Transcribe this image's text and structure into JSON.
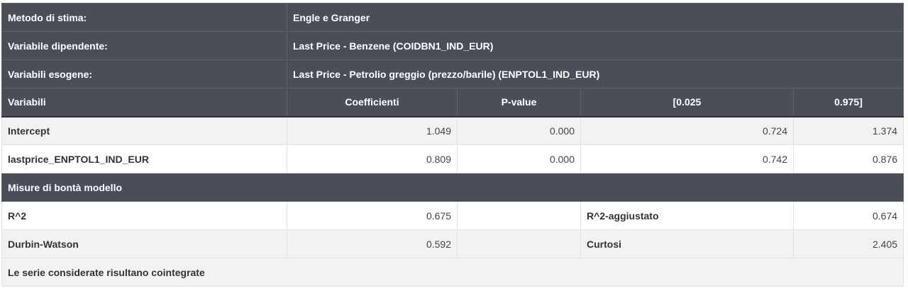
{
  "info": [
    {
      "label": "Metodo di stima:",
      "value": "Engle e Granger"
    },
    {
      "label": "Variabile dipendente:",
      "value": "Last Price - Benzene (COIDBN1_IND_EUR)"
    },
    {
      "label": "Variabili esogene:",
      "value": "Last Price - Petrolio greggio (prezzo/barile) (ENPTOL1_IND_EUR)"
    }
  ],
  "coef_header": [
    "Variabili",
    "Coefficienti",
    "P-value",
    "[0.025",
    "0.975]"
  ],
  "coef_rows": [
    [
      "Intercept",
      "1.049",
      "0.000",
      "0.724",
      "1.374"
    ],
    [
      "lastprice_ENPTOL1_IND_EUR",
      "0.809",
      "0.000",
      "0.742",
      "0.876"
    ]
  ],
  "fit_title": "Misure di bontà modello",
  "fit_rows": [
    {
      "label1": "R^2",
      "value1": "0.675",
      "label2": "R^2-aggiustato",
      "value2": "0.674"
    },
    {
      "label1": "Durbin-Watson",
      "value1": "0.592",
      "label2": "Curtosi",
      "value2": "2.405"
    }
  ],
  "conclusion": "Le serie considerate risultano cointegrate"
}
